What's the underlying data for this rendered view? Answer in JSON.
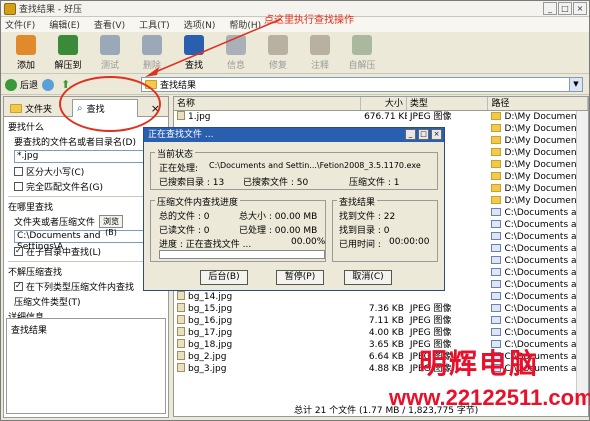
{
  "window": {
    "title": "查找结果 - 好压"
  },
  "menu": [
    "文件(F)",
    "编辑(E)",
    "查看(V)",
    "工具(T)",
    "选项(N)",
    "帮助(H)"
  ],
  "annotation": "点这里执行查找操作",
  "toolbar": [
    {
      "label": "添加",
      "icon": "add-icon",
      "enabled": true
    },
    {
      "label": "解压到",
      "icon": "extract-icon",
      "enabled": true
    },
    {
      "label": "测试",
      "icon": "test-icon",
      "enabled": false
    },
    {
      "label": "删除",
      "icon": "delete-icon",
      "enabled": false
    },
    {
      "label": "查找",
      "icon": "find-icon",
      "enabled": true
    },
    {
      "label": "信息",
      "icon": "info-icon",
      "enabled": false
    },
    {
      "label": "修复",
      "icon": "repair-icon",
      "enabled": false
    },
    {
      "label": "注释",
      "icon": "comment-icon",
      "enabled": false
    },
    {
      "label": "自解压",
      "icon": "sfx-icon",
      "enabled": false
    }
  ],
  "nav": {
    "back": "后退",
    "address": "查找结果"
  },
  "left": {
    "tab_files": "文件夹",
    "tab_find": "查找",
    "tab_close": "×",
    "find_what": "要找什么",
    "name_label": "要查找的文件名或者目录名(D)",
    "name_value": "*.jpg",
    "case": "区分大小写(C)",
    "exact": "完全匹配文件名(G)",
    "where": "在哪里查找",
    "folder_label": "文件夹或者压缩文件",
    "browse": "浏览(B)",
    "folder_value": "C:\\Documents and Settings\\A",
    "subdirs": "在子目录中查找(L)",
    "no_extract": "不解压缩查找",
    "in_archives": "在下列类型压缩文件内查找",
    "archive_types": "压缩文件类型(T)",
    "details": "详细信息",
    "result_text": "查找结果"
  },
  "list": {
    "headers": {
      "name": "名称",
      "size": "大小",
      "type": "类型",
      "path": "路径"
    },
    "rows": [
      {
        "name": "1.jpg",
        "size": "676.71 KB",
        "type": "JPEG 图像",
        "path": "D:\\My Documents\\My Pic",
        "pcolor": "yellow"
      },
      {
        "name": "",
        "size": "",
        "type": "",
        "path": "D:\\My Documents\\新建文",
        "pcolor": "yellow"
      },
      {
        "name": "",
        "size": "",
        "type": "",
        "path": "D:\\My Documents\\新建文",
        "pcolor": "yellow"
      },
      {
        "name": "",
        "size": "",
        "type": "",
        "path": "D:\\My Documents\\新建文",
        "pcolor": "yellow"
      },
      {
        "name": "",
        "size": "",
        "type": "",
        "path": "D:\\My Documents\\新建文",
        "pcolor": "yellow"
      },
      {
        "name": "",
        "size": "",
        "type": "",
        "path": "D:\\My Documents\\新建文",
        "pcolor": "yellow"
      },
      {
        "name": "",
        "size": "",
        "type": "",
        "path": "D:\\My Documents\\新建文",
        "pcolor": "yellow"
      },
      {
        "name": "",
        "size": "",
        "type": "",
        "path": "D:\\My Documents\\新建文",
        "pcolor": "yellow"
      },
      {
        "name": "",
        "size": "",
        "type": "",
        "path": "C:\\Documents and Setti",
        "pcolor": "blue"
      },
      {
        "name": "",
        "size": "",
        "type": "",
        "path": "C:\\Documents and Setti",
        "pcolor": "blue"
      },
      {
        "name": "",
        "size": "",
        "type": "",
        "path": "C:\\Documents and Setti",
        "pcolor": "blue"
      },
      {
        "name": "",
        "size": "",
        "type": "",
        "path": "C:\\Documents and Setti",
        "pcolor": "blue"
      },
      {
        "name": "",
        "size": "",
        "type": "",
        "path": "C:\\Documents and Setti",
        "pcolor": "blue"
      },
      {
        "name": "",
        "size": "",
        "type": "",
        "path": "C:\\Documents and Setti",
        "pcolor": "blue"
      },
      {
        "name": "",
        "size": "",
        "type": "",
        "path": "C:\\Documents and Setti",
        "pcolor": "blue"
      },
      {
        "name": "bg_14.jpg",
        "size": "",
        "type": "",
        "path": "C:\\Documents and Setti",
        "pcolor": "blue"
      },
      {
        "name": "bg_15.jpg",
        "size": "7.36 KB",
        "type": "JPEG 图像",
        "path": "C:\\Documents and Setti",
        "pcolor": "blue"
      },
      {
        "name": "bg_16.jpg",
        "size": "7.11 KB",
        "type": "JPEG 图像",
        "path": "C:\\Documents and Setti",
        "pcolor": "blue"
      },
      {
        "name": "bg_17.jpg",
        "size": "4.00 KB",
        "type": "JPEG 图像",
        "path": "C:\\Documents and Setti",
        "pcolor": "blue"
      },
      {
        "name": "bg_18.jpg",
        "size": "3.65 KB",
        "type": "JPEG 图像",
        "path": "C:\\Documents and Setti",
        "pcolor": "blue"
      },
      {
        "name": "bg_2.jpg",
        "size": "6.64 KB",
        "type": "JPEG 图像",
        "path": "C:\\Documents and Setti",
        "pcolor": "blue"
      },
      {
        "name": "bg_3.jpg",
        "size": "4.88 KB",
        "type": "JPEG 图像",
        "path": "C:\\Documents and Setti",
        "pcolor": "blue"
      }
    ],
    "status": "总计 21 个文件 (1.77 MB / 1,823,775 字节)"
  },
  "dialog": {
    "title": "正在查找文件 ...",
    "current_state": "当前状态",
    "processing_label": "正在处理:",
    "processing_value": "C:\\Documents and Settin...\\Fetion2008_3.5.1170.exe",
    "searched_files": "已搜索目录 : 13",
    "searched_count": "已搜索文件 : 50",
    "archives": "压缩文件 : 1",
    "inner_title": "压缩文件内查找进度",
    "total_files": "总的文件 : 0",
    "total_size": "总大小 : 00.00 MB",
    "done_files": "已读文件 : 0",
    "done_size": "已处理 : 00.00 MB",
    "progress": "进度 : 正在查找文件 ...",
    "progress_pct": "00.00%",
    "results_title": "查找结果",
    "found": "找到文件 : 22",
    "found_dirs": "找到目录 : 0",
    "elapsed": "已用时间 :",
    "elapsed_value": "00:00:00",
    "btn_bg": "后台(B)",
    "btn_pause": "暂停(P)",
    "btn_cancel": "取消(C)"
  },
  "watermark": {
    "line1": "明辉电脑",
    "line2": "www.22122511.com"
  }
}
